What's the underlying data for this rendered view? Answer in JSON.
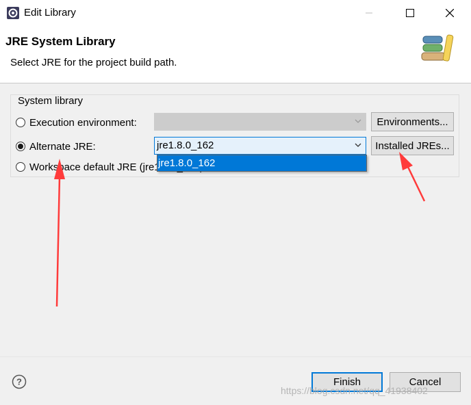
{
  "window": {
    "title": "Edit Library",
    "controls": [
      "minimize-icon",
      "maximize-icon",
      "close-icon"
    ]
  },
  "header": {
    "title": "JRE System Library",
    "subtitle": "Select JRE for the project build path.",
    "icon": "books-icon"
  },
  "system_library": {
    "group_label": "System library",
    "execution_environment": {
      "label": "Execution environment:",
      "selected": false,
      "combo_value": "",
      "combo_enabled": false,
      "button_label": "Environments..."
    },
    "alternate_jre": {
      "label": "Alternate JRE:",
      "selected": true,
      "combo_value": "jre1.8.0_162",
      "dropdown_open": true,
      "dropdown_options": [
        "jre1.8.0_162"
      ],
      "button_label": "Installed JREs..."
    },
    "workspace_default": {
      "label": "Workspace default JRE (jre1.8.0_162)",
      "selected": false
    }
  },
  "footer": {
    "help_icon": "help-icon",
    "finish_label": "Finish",
    "cancel_label": "Cancel"
  },
  "watermark": "https://blog.csdn.net/qq_41938402",
  "colors": {
    "accent": "#0078d7",
    "annotation_arrow": "#ff3b3b"
  }
}
